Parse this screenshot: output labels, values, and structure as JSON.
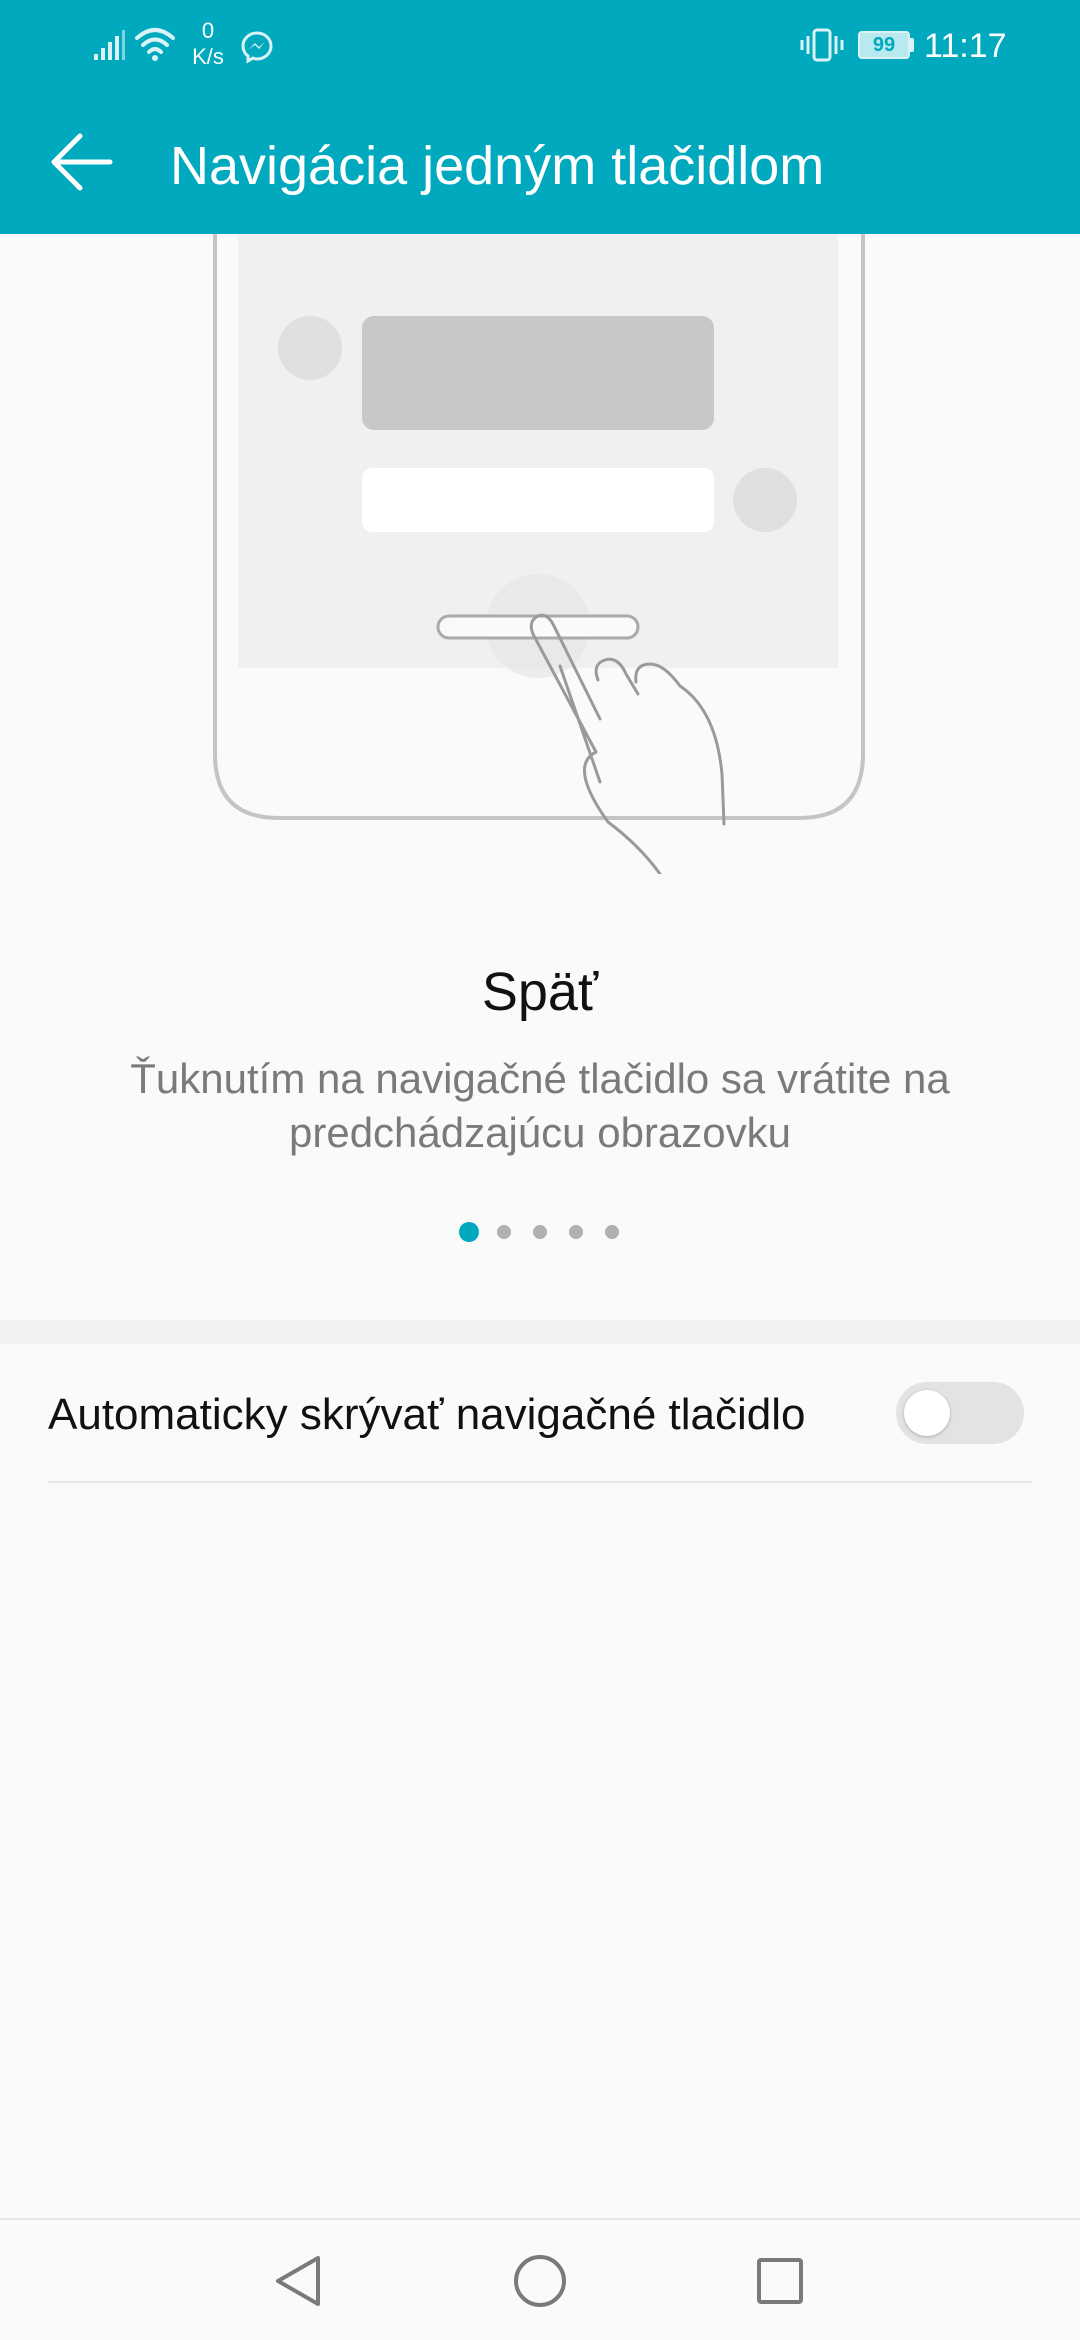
{
  "status_bar": {
    "net_speed_value": "0",
    "net_speed_unit": "K/s",
    "battery": "99",
    "time": "11:17",
    "icons": [
      "signal-icon",
      "wifi-icon",
      "messenger-icon",
      "vibrate-icon",
      "battery-icon"
    ]
  },
  "header": {
    "title": "Navigácia jedným tlačidlom",
    "back_icon": "arrow-left-icon"
  },
  "tutorial": {
    "title": "Späť",
    "description": "Ťuknutím na navigačné tlačidlo sa vrátite na predchádzajúcu obrazovku",
    "page_count": 5,
    "active_page": 1
  },
  "settings": {
    "auto_hide_label": "Automaticky skrývať navigačné tlačidlo",
    "auto_hide_enabled": false
  },
  "nav_bar": {
    "icons": [
      "back-triangle-icon",
      "home-circle-icon",
      "recents-square-icon"
    ]
  },
  "colors": {
    "accent": "#00a9be",
    "background": "#fafafa",
    "text_primary": "#111111",
    "text_secondary": "#7a7a7a"
  }
}
